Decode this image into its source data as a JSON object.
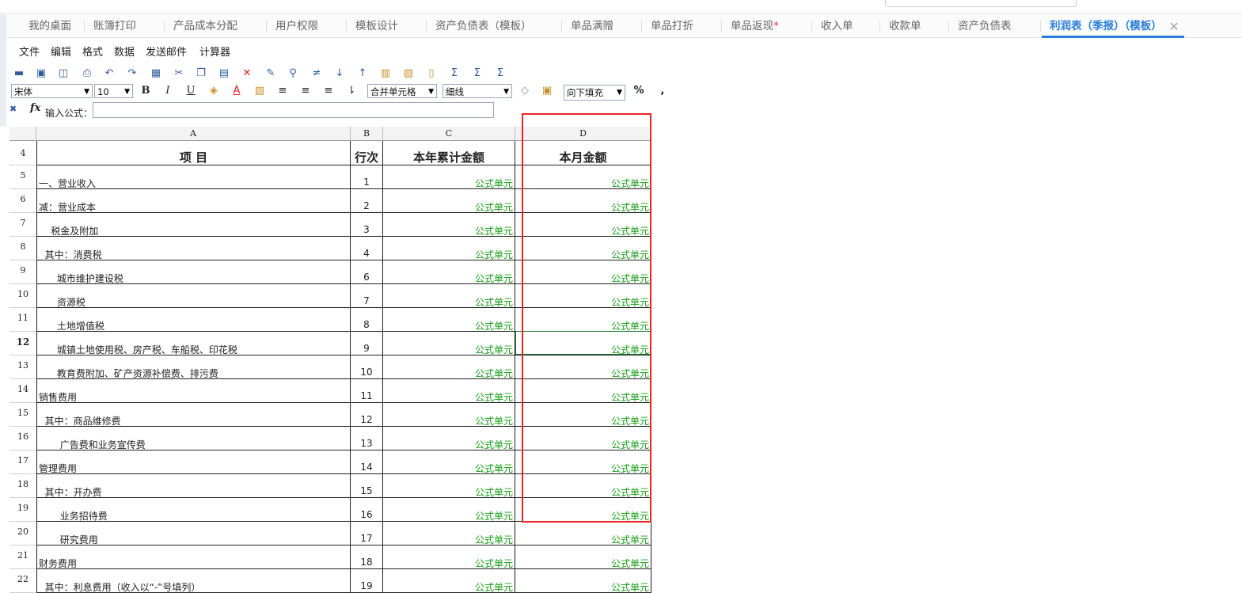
{
  "tabs": [
    {
      "label": "我的桌面"
    },
    {
      "label": "账簿打印"
    },
    {
      "label": "产品成本分配"
    },
    {
      "label": "用户权限"
    },
    {
      "label": "模板设计"
    },
    {
      "label": "资产负债表（模板）"
    },
    {
      "label": "单品满赠"
    },
    {
      "label": "单品打折"
    },
    {
      "label": "单品返现",
      "starred": "*"
    },
    {
      "label": "收入单"
    },
    {
      "label": "收款单"
    },
    {
      "label": "资产负债表"
    },
    {
      "label": "利润表（季报）（模板）",
      "close": "✕"
    }
  ],
  "menu": [
    "文件",
    "编辑",
    "格式",
    "数据",
    "发送邮件",
    "计算器"
  ],
  "format": {
    "font": "宋体",
    "size": "10",
    "merge": "合并单元格",
    "border": "细线",
    "fill": "向下填充",
    "percent": "%",
    "comma": ","
  },
  "formula": {
    "icon": "fx",
    "label": "输入公式：",
    "value": ""
  },
  "columns": [
    "A",
    "B",
    "C",
    "D"
  ],
  "header_row": {
    "row": "4",
    "a": "项    目",
    "b": "行次",
    "c": "本年累计金额",
    "d": "本月金额"
  },
  "rows": [
    {
      "row": "5",
      "a": "一、营业收入",
      "b": "1",
      "c": "公式单元",
      "d": "公式单元"
    },
    {
      "row": "6",
      "a": "减：营业成本",
      "b": "2",
      "c": "公式单元",
      "d": "公式单元"
    },
    {
      "row": "7",
      "a": "    税金及附加",
      "b": "3",
      "c": "公式单元",
      "d": "公式单元"
    },
    {
      "row": "8",
      "a": "  其中：消费税",
      "b": "4",
      "c": "公式单元",
      "d": "公式单元"
    },
    {
      "row": "9",
      "a": "      城市维护建设税",
      "b": "6",
      "c": "公式单元",
      "d": "公式单元"
    },
    {
      "row": "10",
      "a": "      资源税",
      "b": "7",
      "c": "公式单元",
      "d": "公式单元"
    },
    {
      "row": "11",
      "a": "      土地增值税",
      "b": "8",
      "c": "公式单元",
      "d": "公式单元"
    },
    {
      "row": "12",
      "a": "      城镇土地使用税、房产税、车船税、印花税",
      "b": "9",
      "c": "公式单元",
      "d": "公式单元"
    },
    {
      "row": "13",
      "a": "      教育费附加、矿产资源补偿费、排污费",
      "b": "10",
      "c": "公式单元",
      "d": "公式单元"
    },
    {
      "row": "14",
      "a": "销售费用",
      "b": "11",
      "c": "公式单元",
      "d": "公式单元"
    },
    {
      "row": "15",
      "a": "  其中：商品维修费",
      "b": "12",
      "c": "公式单元",
      "d": "公式单元"
    },
    {
      "row": "16",
      "a": "       广告费和业务宣传费",
      "b": "13",
      "c": "公式单元",
      "d": "公式单元"
    },
    {
      "row": "17",
      "a": "管理费用",
      "b": "14",
      "c": "公式单元",
      "d": "公式单元"
    },
    {
      "row": "18",
      "a": "  其中：开办费",
      "b": "15",
      "c": "公式单元",
      "d": "公式单元"
    },
    {
      "row": "19",
      "a": "       业务招待费",
      "b": "16",
      "c": "公式单元",
      "d": "公式单元"
    },
    {
      "row": "20",
      "a": "       研究费用",
      "b": "17",
      "c": "公式单元",
      "d": "公式单元"
    },
    {
      "row": "21",
      "a": "财务费用",
      "b": "18",
      "c": "公式单元",
      "d": "公式单元"
    },
    {
      "row": "22",
      "a": "  其中：利息费用（收入以“-”号填列）",
      "b": "19",
      "c": "公式单元",
      "d": "公式单元"
    }
  ],
  "selected_row": "12",
  "colors": {
    "accent": "#2a7ddb",
    "formula_text": "#15a015",
    "highlight": "#e22222"
  }
}
